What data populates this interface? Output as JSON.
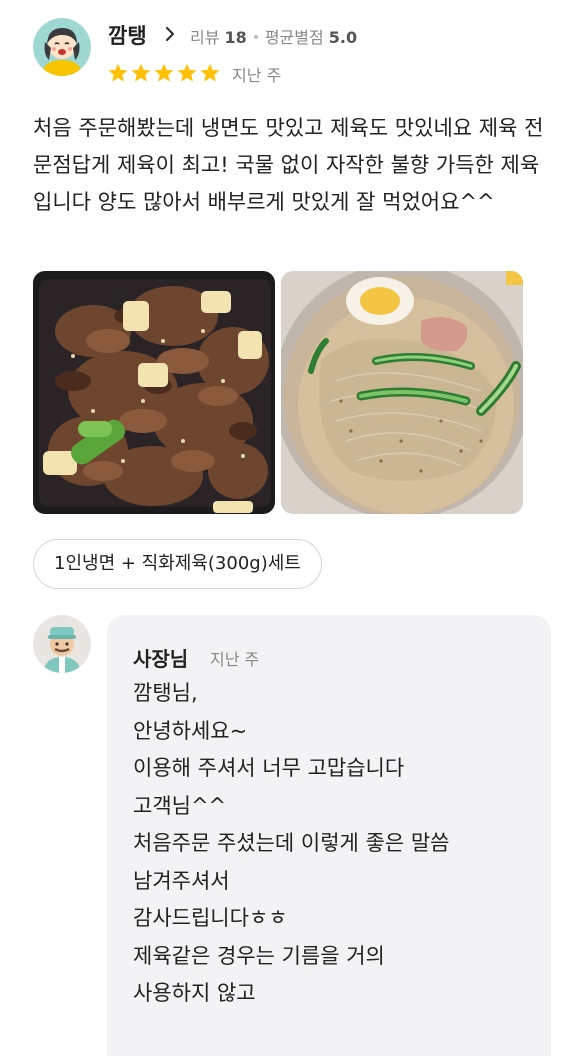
{
  "review": {
    "nickname": "깜탱",
    "review_count_label": "리뷰",
    "review_count": "18",
    "avg_rating_label": "평균별점",
    "avg_rating": "5.0",
    "rating": 5,
    "star_color": "#FFC107",
    "time": "지난 주",
    "body": "처음 주문해봤는데 냉면도 맛있고 제육도 맛있네요 제육 전문점답게 제육이 최고! 국물 없이 자작한 불향 가득한 제육입니다 양도 많아서 배부르게 맛있게 잘 먹었어요^^",
    "photos": [
      "jeyuk-photo",
      "naengmyeon-photo"
    ],
    "menu": "1인냉면 + 직화제육(300g)세트"
  },
  "owner_reply": {
    "name": "사장님",
    "time": "지난 주",
    "lines": [
      "깜탱님,",
      "안녕하세요~",
      "이용해 주셔서 너무 고맙습니다",
      "고객님^^",
      "처음주문 주셨는데 이렇게 좋은 말씀",
      "남겨주셔서",
      "감사드립니다ㅎㅎ",
      "제육같은 경우는 기름을 거의",
      "사용하지 않고"
    ]
  }
}
